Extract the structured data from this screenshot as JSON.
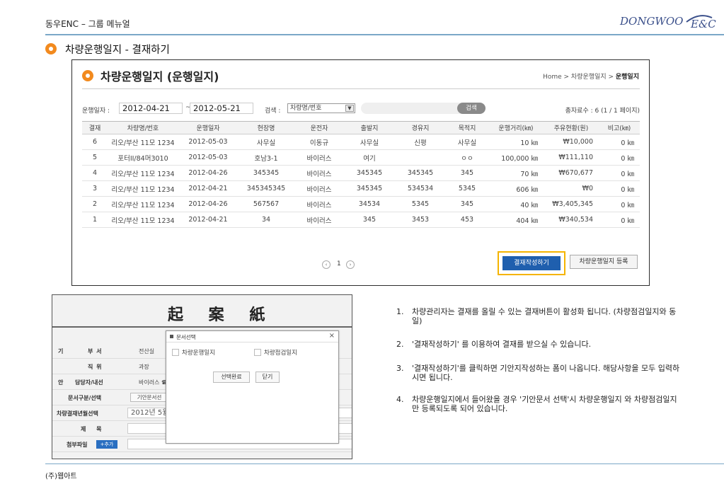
{
  "header": {
    "doc_title": "동우ENC – 그룹 메뉴얼",
    "logo_main": "DONGWOO",
    "logo_sub": "E&C"
  },
  "section": {
    "title": "차량운행일지 - 결재하기"
  },
  "shot1": {
    "title": "차량운행일지 (운행일지)",
    "breadcrumb": {
      "home": "Home",
      "parent": "차량운행일지",
      "current": "운행일지",
      "sep": " > "
    },
    "filter": {
      "date_label": "운행일자 :",
      "date_from": "2012-04-21",
      "tilde": "~",
      "date_to": "2012-05-21",
      "search_label": "검색 :",
      "search_field": "차량명/번호",
      "search_button": "검색",
      "total": "총자료수 : 6 (1 / 1 페이지)"
    },
    "columns": [
      "결재",
      "차량명/번호",
      "운행일자",
      "현장명",
      "운전자",
      "출발지",
      "경유지",
      "목적지",
      "운행거리(㎞)",
      "주유현황(원)",
      "비고(㎞)"
    ],
    "rows": [
      {
        "no": "6",
        "car": "리오/부산 11모 1234",
        "date": "2012-05-03",
        "site": "사무실",
        "driver": "이동규",
        "from": "사무실",
        "via": "신평",
        "to": "사무실",
        "dist": "10 ㎞",
        "fuel": "₩10,000",
        "note": "0 ㎞"
      },
      {
        "no": "5",
        "car": "포터II/84머3010",
        "date": "2012-05-03",
        "site": "호남3-1",
        "driver": "바이러스",
        "from": "여기",
        "via": "",
        "to": "ㅇㅇ",
        "dist": "100,000 ㎞",
        "fuel": "₩111,110",
        "note": "0 ㎞"
      },
      {
        "no": "4",
        "car": "리오/부산 11모 1234",
        "date": "2012-04-26",
        "site": "345345",
        "driver": "바이러스",
        "from": "345345",
        "via": "345345",
        "to": "345",
        "dist": "70 ㎞",
        "fuel": "₩670,677",
        "note": "0 ㎞"
      },
      {
        "no": "3",
        "car": "리오/부산 11모 1234",
        "date": "2012-04-21",
        "site": "345345345",
        "driver": "바이러스",
        "from": "345345",
        "via": "534534",
        "to": "5345",
        "dist": "606 ㎞",
        "fuel": "₩0",
        "note": "0 ㎞"
      },
      {
        "no": "2",
        "car": "리오/부산 11모 1234",
        "date": "2012-04-26",
        "site": "567567",
        "driver": "바이러스",
        "from": "34534",
        "via": "5345",
        "to": "345",
        "dist": "40 ㎞",
        "fuel": "₩3,405,345",
        "note": "0 ㎞"
      },
      {
        "no": "1",
        "car": "리오/부산 11모 1234",
        "date": "2012-04-21",
        "site": "34",
        "driver": "바이러스",
        "from": "345",
        "via": "3453",
        "to": "453",
        "dist": "404 ㎞",
        "fuel": "₩340,534",
        "note": "0 ㎞"
      }
    ],
    "pager": {
      "prev": "‹",
      "page": "1",
      "next": "›"
    },
    "buttons": {
      "approve": "결재작성하기",
      "register": "차량운행일지 등록"
    }
  },
  "shot2": {
    "title": "起 案 紙",
    "side_top": "기",
    "side_bottom": "안",
    "fields": {
      "dept_label": "부 서",
      "dept_value": "전산실",
      "position_label": "직 위",
      "position_value": "과장",
      "person_label": "담당자/내선",
      "person_value": "바이러스 ☎ C",
      "doc_type_label": "문서구분/선택",
      "doc_type_button": "기안문서선",
      "month_label": "차량결재년월선택",
      "month_value": "2012년 5월",
      "subject_label": "제 목",
      "attach_label": "첨부파일",
      "attach_button": "+추가"
    },
    "modal": {
      "title": "문서선택",
      "close": "×",
      "option1": "차량운행일지",
      "option2": "차량점검일지",
      "confirm": "선택완료",
      "close_button": "닫기"
    }
  },
  "steps": [
    {
      "num": "1.",
      "text": "차량관리자는 결재를 올릴 수 있는 결재버튼이 활성화 됩니다. (차량점검일지와 동일)"
    },
    {
      "num": "2.",
      "text": "'결재작성하기' 를 이용하여 결재를 받으실 수 있습니다."
    },
    {
      "num": "3.",
      "text": "'결재작성하기'를 클릭하면 기안지작성하는 폼이 나옵니다. 해당사항을 모두 입력하시면 됩니다."
    },
    {
      "num": "4.",
      "text": "차량운행일지에서 들어왔을 경우 '기안문서 선택'시 차량운행일지 와 차량점검일지 만 등록되도록 되어 있습니다."
    }
  ],
  "footer": {
    "company": "(주)웹아트"
  },
  "colors": {
    "accent_orange": "#f28a1e",
    "approve_blue": "#1f5fae",
    "highlight_yellow": "#f5b400",
    "rule_blue": "#7ba7c8"
  }
}
